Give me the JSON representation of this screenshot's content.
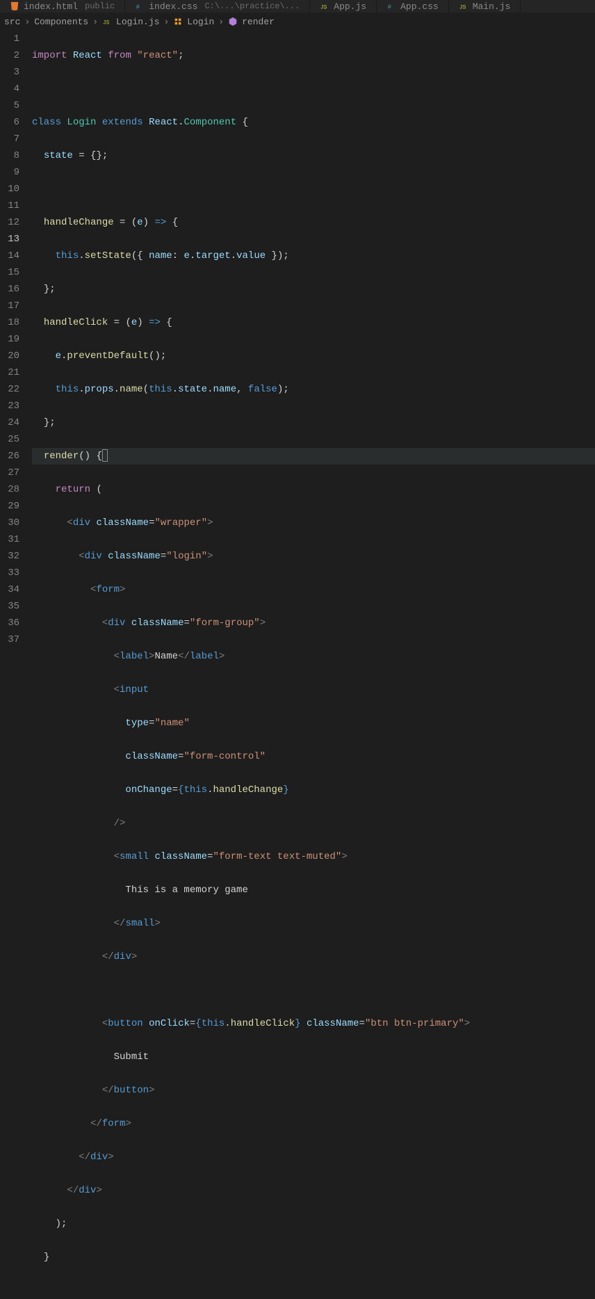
{
  "tabs": [
    {
      "icon": "html",
      "label": "index.html",
      "sub": "public"
    },
    {
      "icon": "css",
      "label": "index.css",
      "sub": "C:\\...\\practice\\..."
    },
    {
      "icon": "js",
      "label": "App.js",
      "sub": ""
    },
    {
      "icon": "css",
      "label": "App.css",
      "sub": ""
    },
    {
      "icon": "js",
      "label": "Main.js",
      "sub": ""
    }
  ],
  "breadcrumb": {
    "a": "src",
    "b": "Components",
    "c": "Login.js",
    "d": "Login",
    "e": "render"
  },
  "lines": {
    "l1": "1",
    "l2": "2",
    "l3": "3",
    "l4": "4",
    "l5": "5",
    "l6": "6",
    "l7": "7",
    "l8": "8",
    "l9": "9",
    "l10": "10",
    "l11": "11",
    "l12": "12",
    "l13": "13",
    "l14": "14",
    "l15": "15",
    "l16": "16",
    "l17": "17",
    "l18": "18",
    "l19": "19",
    "l20": "20",
    "l21": "21",
    "l22": "22",
    "l23": "23",
    "l24": "24",
    "l25": "25",
    "l26": "26",
    "l27": "27",
    "l28": "28",
    "l29": "29",
    "l30": "30",
    "l31": "31",
    "l32": "32",
    "l33": "33",
    "l34": "34",
    "l35": "35",
    "l36": "36",
    "l37": "37"
  },
  "code": {
    "import": "import",
    "react_name": "React",
    "from": "from",
    "react_str": "\"react\"",
    "semi": ";",
    "class": "class",
    "login": "Login",
    "extends": "extends",
    "dot": ".",
    "component": "Component",
    "ob": "{",
    "cb": "}",
    "state": "state",
    "eq": " = ",
    "empty_obj": "{};",
    "handleChange": "handleChange",
    "arrow_e": " = (",
    "e_param": "e",
    "arrow_mid": ") ",
    "arrow": "=>",
    "this": "this",
    "setState": "setState",
    "op": "(",
    "cp": ")",
    "name_prop": "name",
    "colon": ":",
    "target": "target",
    "value": "value",
    "close_brace_semi": "};",
    "handleClick": "handleClick",
    "preventDefault": "preventDefault",
    "empty_call": "();",
    "props": "props",
    "name_fn": "name",
    "comma": ",",
    "false": "false",
    "render": "render",
    "render_paren": "()",
    "return": "return",
    "lt": "<",
    "gt": ">",
    "slash": "/",
    "div": "div",
    "form": "form",
    "label": "label",
    "input": "input",
    "small": "small",
    "button": "button",
    "className": "className",
    "eq2": "=",
    "wrapper": "\"wrapper\"",
    "login_str": "\"login\"",
    "form_group": "\"form-group\"",
    "name_text": "Name",
    "type_attr": "type",
    "name_str": "\"name\"",
    "form_control": "\"form-control\"",
    "onChange": "onChange",
    "self_close": "/>",
    "form_text": "\"form-text text-muted\"",
    "memory_text": "This is a memory game",
    "onClick": "onClick",
    "btn_primary": "\"btn btn-primary\"",
    "submit": "Submit",
    "close_paren_semi": ");"
  }
}
